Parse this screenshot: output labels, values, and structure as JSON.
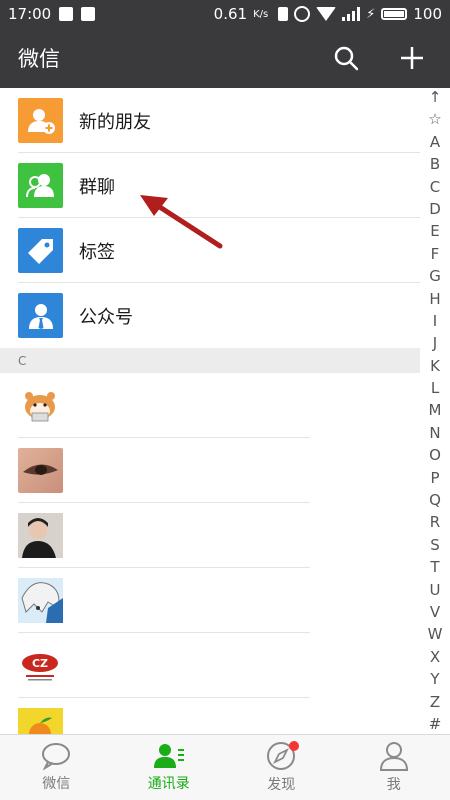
{
  "status_bar": {
    "time": "17:00",
    "net_speed": "0.61",
    "net_unit": "K/s",
    "battery": "100"
  },
  "header": {
    "title": "微信",
    "search_icon": "search-icon",
    "add_icon": "plus-icon"
  },
  "entries": [
    {
      "label": "新的朋友",
      "color": "#f79c35",
      "icon": "add-friend-icon"
    },
    {
      "label": "群聊",
      "color": "#3fc23f",
      "icon": "group-icon"
    },
    {
      "label": "标签",
      "color": "#2f86d8",
      "icon": "tag-icon"
    },
    {
      "label": "公众号",
      "color": "#2f86d8",
      "icon": "official-account-icon"
    }
  ],
  "section": {
    "letter": "C"
  },
  "contacts_count_visible": 6,
  "index_letters": [
    "↑",
    "☆",
    "A",
    "B",
    "C",
    "D",
    "E",
    "F",
    "G",
    "H",
    "I",
    "J",
    "K",
    "L",
    "M",
    "N",
    "O",
    "P",
    "Q",
    "R",
    "S",
    "T",
    "U",
    "V",
    "W",
    "X",
    "Y",
    "Z",
    "#"
  ],
  "tabs": [
    {
      "label": "微信",
      "icon": "chat-bubble-icon",
      "active": false
    },
    {
      "label": "通讯录",
      "icon": "contacts-icon",
      "active": true
    },
    {
      "label": "发现",
      "icon": "compass-icon",
      "active": false,
      "badge": true
    },
    {
      "label": "我",
      "icon": "person-icon",
      "active": false
    }
  ],
  "colors": {
    "bar": "#3a3a3c",
    "accent": "#1aad19",
    "badge": "#f43530",
    "arrow": "#b01e1e"
  }
}
